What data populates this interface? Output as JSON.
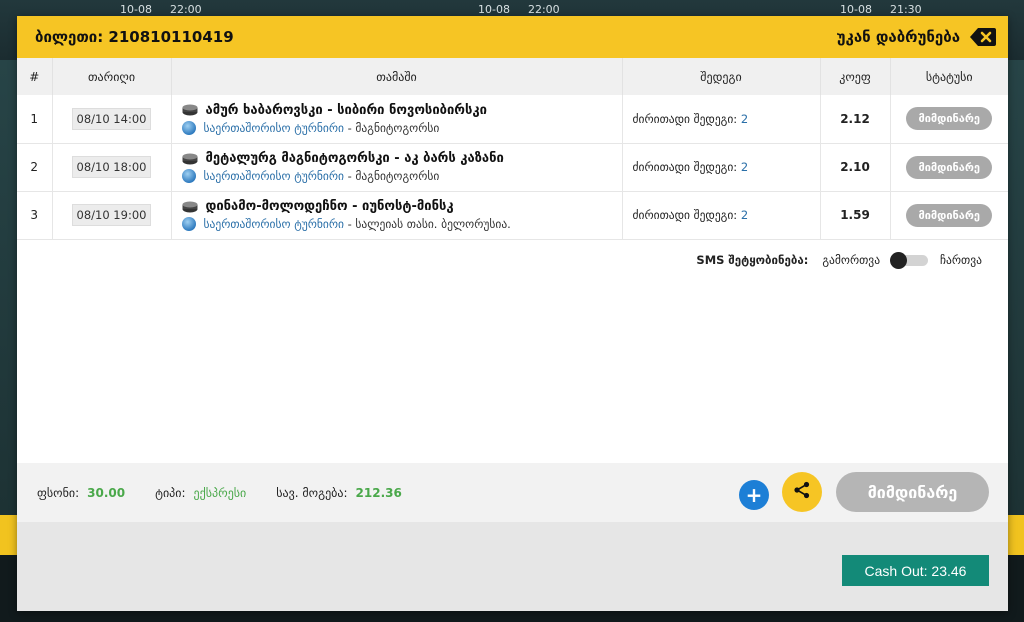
{
  "background": {
    "matches": [
      {
        "date": "10-08",
        "time": "22:00"
      },
      {
        "date": "10-08",
        "time": "22:00"
      },
      {
        "date": "10-08",
        "time": "21:30"
      }
    ]
  },
  "modal": {
    "ticket_label": "ბილეთი: 210810110419",
    "return_label": "უკან დაბრუნება",
    "columns": {
      "num": "#",
      "date": "თარიღი",
      "game": "თამაში",
      "result": "შედეგი",
      "odds": "კოეფ",
      "status": "სტატუსი"
    },
    "rows": [
      {
        "num": "1",
        "date": "08/10 14:00",
        "teams": "ამურ ხაბაროვსკი - სიბირი ნოვოსიბირსკი",
        "league": "საერთაშორისო ტურნირი",
        "location": " - მაგნიტოგორსი",
        "result_label": "ძირითადი შედეგი: ",
        "result_value": "2",
        "odds": "2.12",
        "status": "მიმდინარე"
      },
      {
        "num": "2",
        "date": "08/10 18:00",
        "teams": "მეტალურგ მაგნიტოგორსკი - აკ ბარს კაზანი",
        "league": "საერთაშორისო ტურნირი",
        "location": " - მაგნიტოგორსი",
        "result_label": "ძირითადი შედეგი: ",
        "result_value": "2",
        "odds": "2.10",
        "status": "მიმდინარე"
      },
      {
        "num": "3",
        "date": "08/10 19:00",
        "teams": "დინამო-მოლოდეჩნო - იუნოსტ-მინსკ",
        "league": "საერთაშორისო ტურნირი",
        "location": " - სალეიას თასი. ბელორუსია.",
        "result_label": "ძირითადი შედეგი: ",
        "result_value": "2",
        "odds": "1.59",
        "status": "მიმდინარე"
      }
    ],
    "sms": {
      "label": "SMS შეტყობინება:",
      "off_label": "გამორთვა",
      "on_label": "ჩართვა"
    },
    "summary": {
      "stake_label": "ფსონი:",
      "stake_value": "30.00",
      "type_label": "ტიპი:",
      "type_value": "ექსპრესი",
      "win_label": "სავ. მოგება:",
      "win_value": "212.36"
    },
    "plus_label": "+",
    "status_big": "მიმდინარე",
    "cashout_label": "Cash Out: 23.46"
  },
  "colors": {
    "header_yellow": "#f6c524",
    "cashout_green": "#138a78",
    "link_blue": "#2a6fa8",
    "value_green": "#4aa84a",
    "status_gray": "#a9a9a9"
  },
  "icons": {
    "close": "backspace-close-icon",
    "puck": "hockey-puck-icon",
    "globe": "globe-icon",
    "share": "share-icon",
    "plus": "plus-icon"
  }
}
